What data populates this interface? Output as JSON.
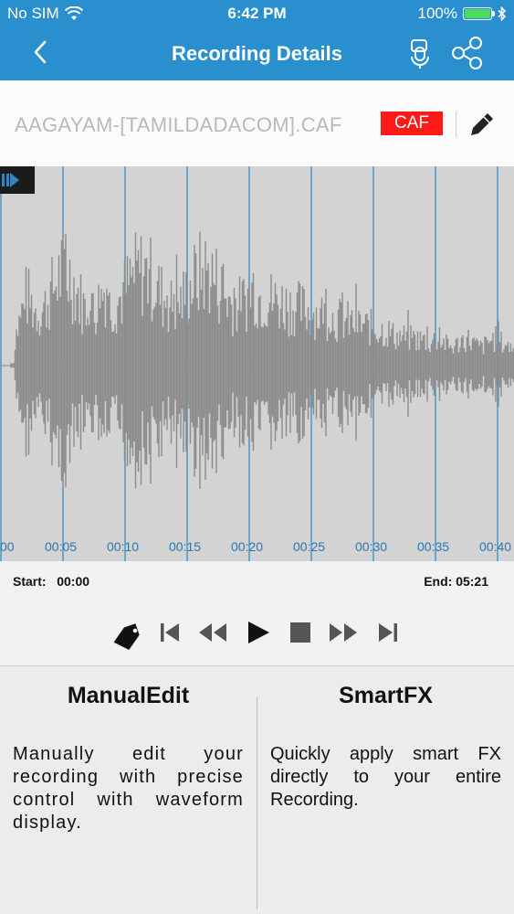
{
  "status": {
    "carrier": "No SIM",
    "time": "6:42 PM",
    "battery": "100%"
  },
  "nav": {
    "title": "Recording Details"
  },
  "file": {
    "name": "AAGAYAM-[TAMILDADACOM].CAF",
    "format": "CAF"
  },
  "timeline": {
    "ticks": [
      "00",
      "00:05",
      "00:10",
      "00:15",
      "00:20",
      "00:25",
      "00:30",
      "00:35",
      "00:40"
    ]
  },
  "range": {
    "start_label": "Start:",
    "start_value": "00:00",
    "end_label": "End:",
    "end_value": "05:21"
  },
  "controls": [
    "tag-icon",
    "skip-start-icon",
    "rewind-icon",
    "play-icon",
    "stop-icon",
    "fast-forward-icon",
    "skip-end-icon"
  ],
  "panels": {
    "manual": {
      "title": "ManualEdit",
      "text": "Manually edit your recording with precise control with waveform display."
    },
    "smart": {
      "title": "SmartFX",
      "text": "Quickly apply smart FX directly to your entire Recording."
    }
  },
  "colors": {
    "accent": "#2a8fcf",
    "badge": "#ff1a1a",
    "waveform": "#8c8c8c",
    "gridline": "#2b87c6"
  }
}
